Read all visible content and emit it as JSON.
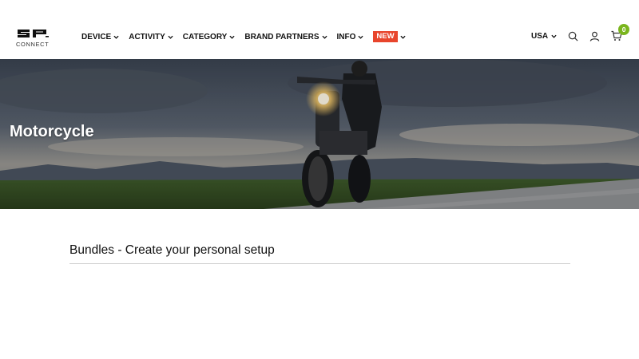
{
  "brand": {
    "logo_text": "CONNECT",
    "logo_alt": "SP CONNECT"
  },
  "nav": {
    "items": [
      {
        "label": "DEVICE"
      },
      {
        "label": "ACTIVITY"
      },
      {
        "label": "CATEGORY"
      },
      {
        "label": "BRAND PARTNERS"
      },
      {
        "label": "INFO"
      }
    ],
    "new_label": "NEW"
  },
  "tools": {
    "country": "USA",
    "cart_count": "0",
    "icons": [
      "search-icon",
      "account-icon",
      "cart-icon"
    ]
  },
  "hero": {
    "title": "Motorcycle"
  },
  "main": {
    "section_title": "Bundles - Create your personal setup"
  },
  "colors": {
    "new_badge": "#e8452c",
    "cart_badge": "#7ab51d",
    "text": "#111111",
    "rule": "#cfcfcf"
  }
}
